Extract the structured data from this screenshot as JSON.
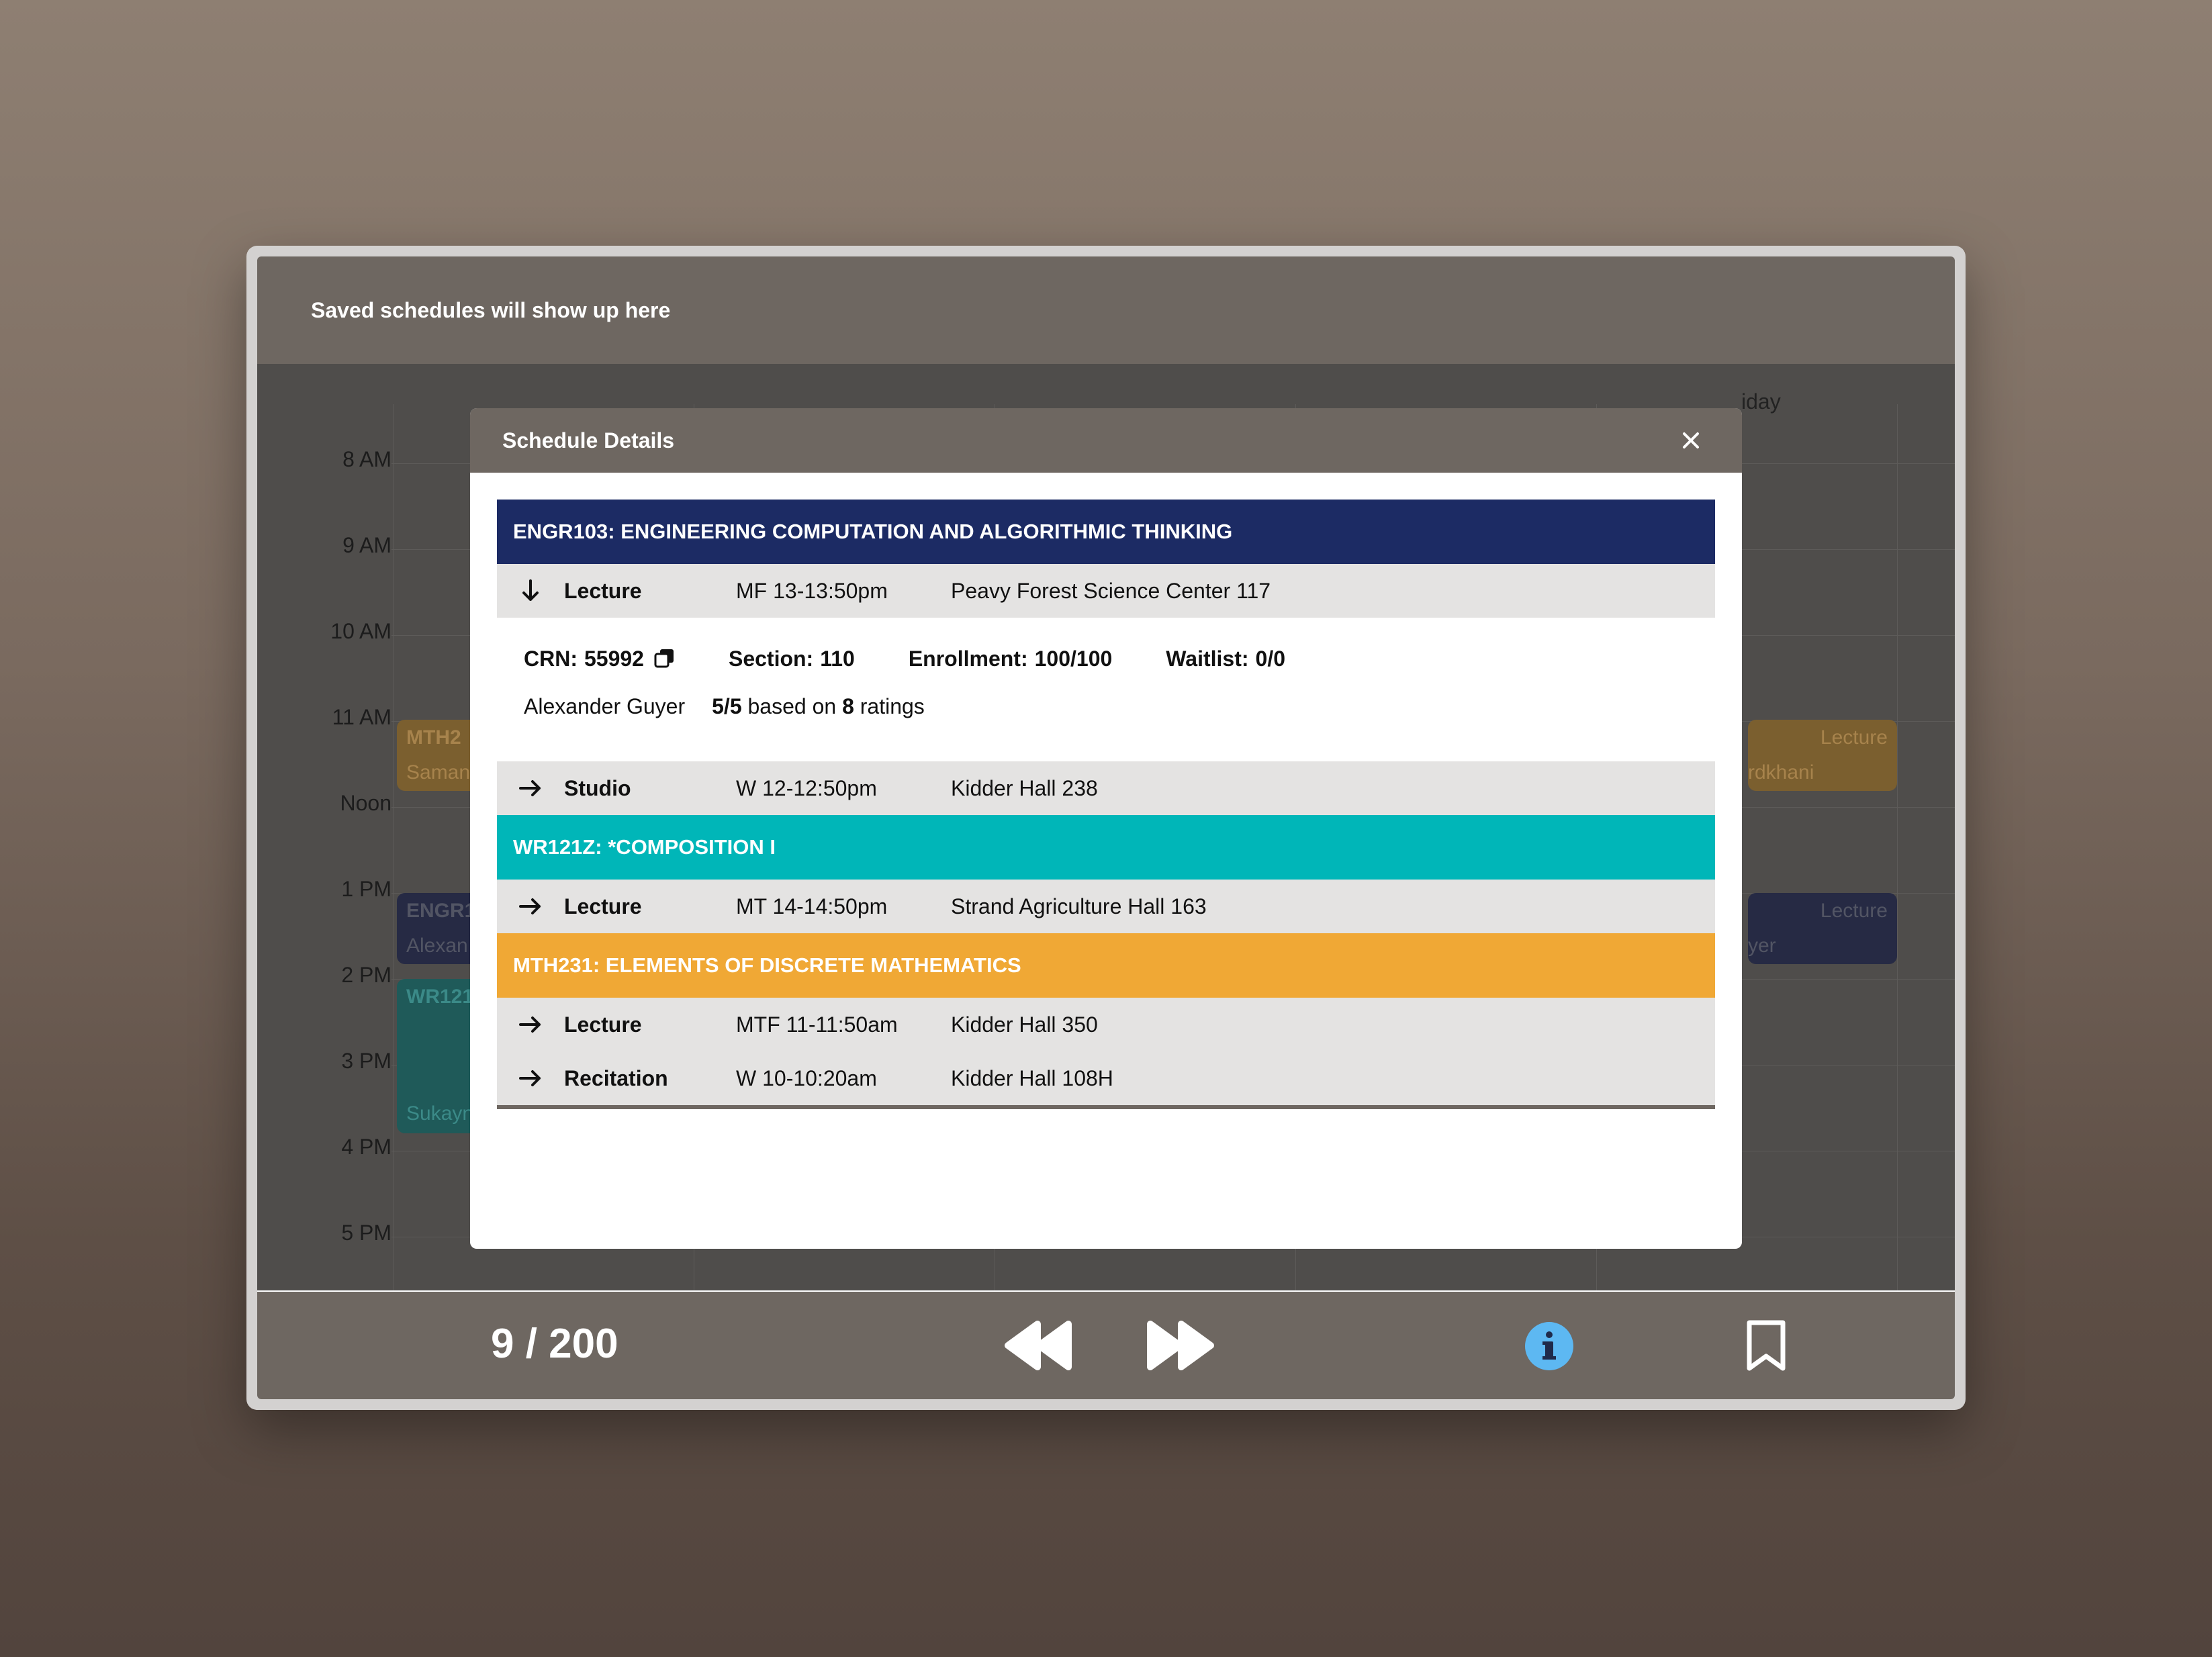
{
  "app": {
    "header_text": "Saved schedules will show up here"
  },
  "calendar": {
    "times": [
      "8 AM",
      "9 AM",
      "10 AM",
      "11 AM",
      "Noon",
      "1 PM",
      "2 PM",
      "3 PM",
      "4 PM",
      "5 PM"
    ],
    "day_header_partial": "iday",
    "events": {
      "mth_left": {
        "title": "MTH2",
        "name": "Saman"
      },
      "engr_left": {
        "title": "ENGR1",
        "name": "Alexan"
      },
      "wr_left": {
        "title": "WR121",
        "name": "Sukayn"
      },
      "mth_right": {
        "type": "Lecture",
        "name": "rdkhani"
      },
      "engr_right": {
        "type": "Lecture",
        "name": "yer"
      }
    }
  },
  "footer": {
    "page_counter": "9 / 200"
  },
  "modal": {
    "title": "Schedule Details",
    "courses": [
      {
        "header": "ENGR103: ENGINEERING COMPUTATION AND ALGORITHMIC THINKING",
        "color": "#1c2b64",
        "meetings": [
          {
            "arrow": "down",
            "type": "Lecture",
            "time": "MF 13-13:50pm",
            "location": "Peavy Forest Science Center 117"
          },
          {
            "arrow": "right",
            "type": "Studio",
            "time": "W 12-12:50pm",
            "location": "Kidder Hall 238"
          }
        ],
        "details": {
          "crn_label": "CRN:",
          "crn": "55992",
          "section_label": "Section:",
          "section": "110",
          "enrollment_label": "Enrollment:",
          "enrollment": "100/100",
          "waitlist_label": "Waitlist:",
          "waitlist": "0/0",
          "instructor": "Alexander Guyer",
          "rating": "5/5",
          "rating_mid": "based on",
          "rating_count": "8",
          "rating_suffix": "ratings"
        }
      },
      {
        "header": "WR121Z: *COMPOSITION I",
        "color": "#00b6b8",
        "meetings": [
          {
            "arrow": "right",
            "type": "Lecture",
            "time": "MT 14-14:50pm",
            "location": "Strand Agriculture Hall 163"
          }
        ]
      },
      {
        "header": "MTH231: ELEMENTS OF DISCRETE MATHEMATICS",
        "color": "#f0a835",
        "meetings": [
          {
            "arrow": "right",
            "type": "Lecture",
            "time": "MTF 11-11:50am",
            "location": "Kidder Hall 350"
          },
          {
            "arrow": "right",
            "type": "Recitation",
            "time": "W 10-10:20am",
            "location": "Kidder Hall 108H"
          }
        ]
      }
    ]
  },
  "icons": {
    "close": "close-icon",
    "copy": "copy-icon",
    "arrow_down": "arrow-down-icon",
    "arrow_right": "arrow-right-icon",
    "rewind": "rewind-icon",
    "fast_forward": "fast-forward-icon",
    "info": "info-icon",
    "bookmark": "bookmark-icon"
  },
  "colors": {
    "info_accent": "#5db8f2",
    "chrome": "#6e6761"
  }
}
